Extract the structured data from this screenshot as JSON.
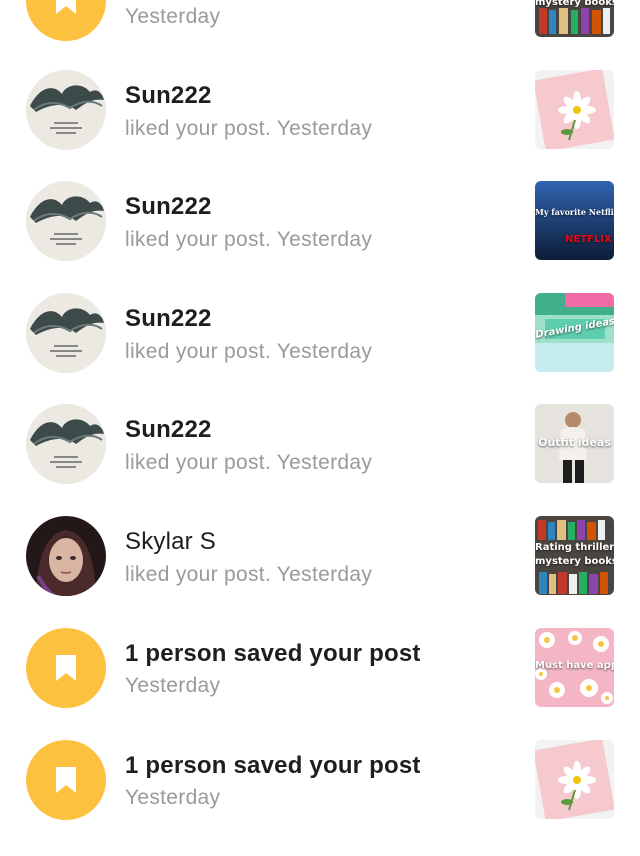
{
  "rows": [
    {
      "type": "saved",
      "title": "",
      "subtitle": "Yesterday",
      "thumb": {
        "text": "mystery books",
        "style": "books"
      }
    },
    {
      "type": "like",
      "title": "Sun222",
      "subtitle": "liked your post. Yesterday",
      "thumb": {
        "text": "",
        "style": "daisy-card"
      }
    },
    {
      "type": "like",
      "title": "Sun222",
      "subtitle": "liked your post. Yesterday",
      "thumb": {
        "text": "My favorite Netflix shows",
        "text2": "NETFLIX",
        "style": "netflix"
      }
    },
    {
      "type": "like",
      "title": "Sun222",
      "subtitle": "liked your post. Yesterday",
      "thumb": {
        "text": "Drawing ideas",
        "style": "drawing"
      }
    },
    {
      "type": "like",
      "title": "Sun222",
      "subtitle": "liked your post. Yesterday",
      "thumb": {
        "text": "Outfit ideas",
        "style": "outfit"
      }
    },
    {
      "type": "like",
      "title": "Skylar S",
      "subtitle": "liked your post. Yesterday",
      "thumb": {
        "text": "Rating thriller/",
        "text2": "mystery books",
        "style": "books"
      }
    },
    {
      "type": "saved",
      "title": "1 person saved your post",
      "subtitle": "Yesterday",
      "thumb": {
        "text": "Must have apps",
        "style": "daisies"
      }
    },
    {
      "type": "saved",
      "title": "1 person saved your post",
      "subtitle": "Yesterday",
      "thumb": {
        "text": "",
        "style": "daisy-card"
      }
    }
  ],
  "colors": {
    "saved_icon_bg": "#fcc23f",
    "subtitle": "#9a9a9a",
    "title": "#1e1e1e"
  }
}
